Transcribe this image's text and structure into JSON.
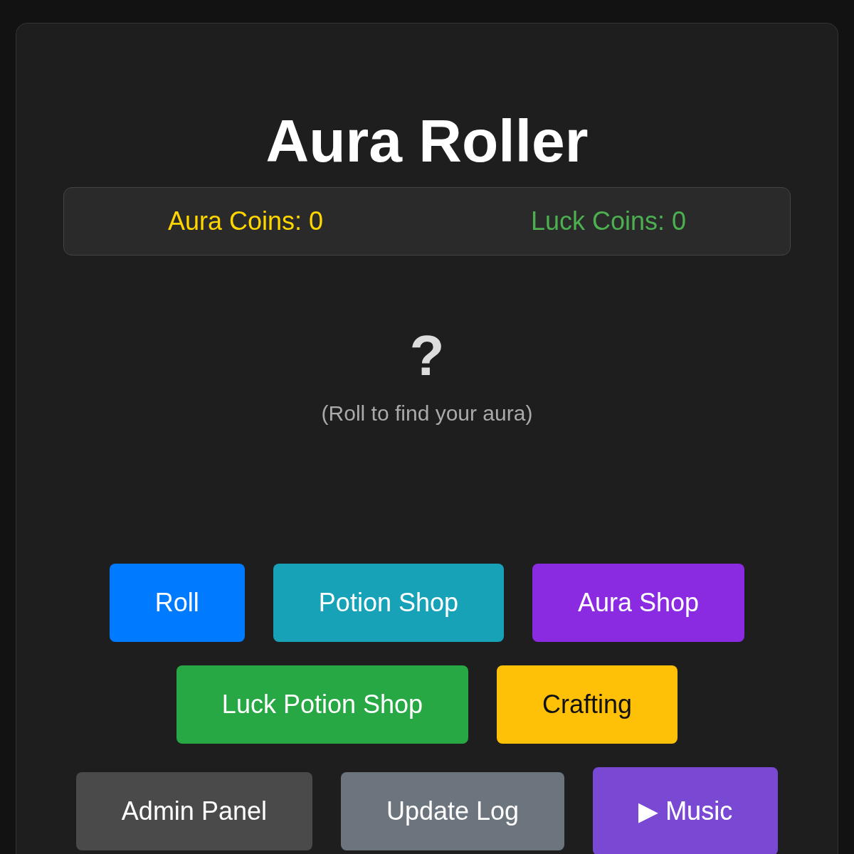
{
  "title": "Aura Roller",
  "coins": [
    {
      "label": "Aura Coins: 0",
      "color": "#ffd600"
    },
    {
      "label": "Luck Coins: 0",
      "color": "#4caf50"
    }
  ],
  "aura": {
    "symbol": "?",
    "hint": "(Roll to find your aura)"
  },
  "buttons": [
    {
      "label": "Roll",
      "color": "#007bff",
      "dark_text": false,
      "hovered": false
    },
    {
      "label": "Potion Shop",
      "color": "#17a2b8",
      "dark_text": false,
      "hovered": false
    },
    {
      "label": "Aura Shop",
      "color": "#8a2be2",
      "dark_text": false,
      "hovered": false
    },
    {
      "label": "Luck Potion Shop",
      "color": "#28a745",
      "dark_text": false,
      "hovered": false
    },
    {
      "label": "Crafting",
      "color": "#ffc107",
      "dark_text": true,
      "hovered": false
    },
    {
      "label": "Admin Panel",
      "color": "#4a4a4a",
      "dark_text": false,
      "hovered": false
    },
    {
      "label": "Update Log",
      "color": "#6c757d",
      "dark_text": false,
      "hovered": false
    },
    {
      "label": "▶ Music",
      "color": "#6f42c1",
      "dark_text": false,
      "hovered": true
    }
  ]
}
